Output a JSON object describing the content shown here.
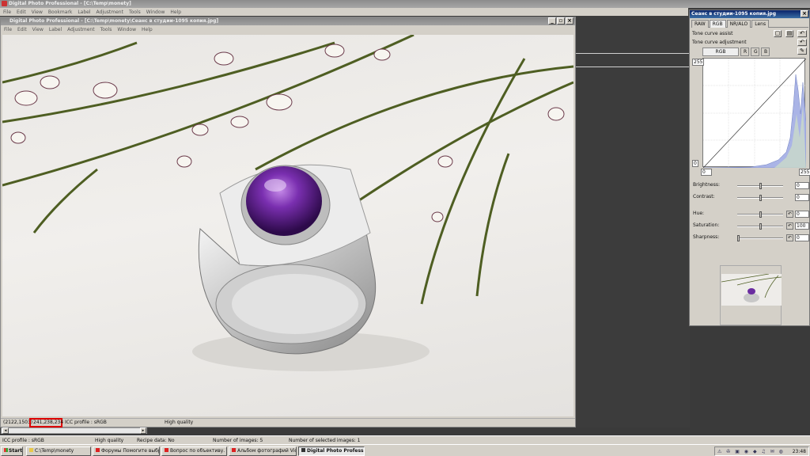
{
  "app": {
    "title": "Digital Photo Professional - [C:\\Temp\\monety]"
  },
  "menu": [
    "File",
    "Edit",
    "View",
    "Bookmark",
    "Label",
    "Adjustment",
    "Tools",
    "Window",
    "Help"
  ],
  "image_window": {
    "title": "Digital Photo Professional - [C:\\Temp\\monety\\Сеанс в студии-1095 копия.jpg]",
    "menu": [
      "File",
      "Edit",
      "View",
      "Label",
      "Adjustment",
      "Tools",
      "Window",
      "Help"
    ],
    "status": {
      "coords": "(2122,1503)",
      "rgb": "241,238,234",
      "icc": "ICC profile : sRGB",
      "quality": "High quality"
    }
  },
  "main_status": {
    "icc": "ICC profile : sRGB",
    "quality": "High quality",
    "recipe": "Recipe data: No",
    "images": "Number of images: 5",
    "selected": "Number of selected images: 1"
  },
  "tool_palette": {
    "title": "Сеанс в студии-1095 копия.jpg",
    "tabs": [
      "RAW",
      "RGB",
      "NR/ALO",
      "Lens"
    ],
    "active_tab": "RGB",
    "tone_curve_assist": "Tone curve assist",
    "tone_curve_adjustment": "Tone curve adjustment",
    "channels": [
      "RGB",
      "R",
      "G",
      "B"
    ],
    "axis": {
      "top": "255",
      "bottom": "0",
      "x_min": "0",
      "x_max": "255"
    },
    "sliders": [
      {
        "label": "Brightness:",
        "value": "0",
        "pos": 0.5
      },
      {
        "label": "Contrast:",
        "value": "0",
        "pos": 0.5
      },
      {
        "label": "Hue:",
        "value": "0",
        "pos": 0.5
      },
      {
        "label": "Saturation:",
        "value": "100",
        "pos": 0.5
      },
      {
        "label": "Sharpness:",
        "value": "0",
        "pos": 0.0
      }
    ]
  },
  "taskbar": {
    "start": "Start",
    "items": [
      "C:\\Temp\\monety",
      "Форумы Помогите выбр...",
      "Вопрос по объективу. |...",
      "Альбом фотографий Vid...",
      "Digital Photo Professi..."
    ],
    "clock": "23:48"
  }
}
